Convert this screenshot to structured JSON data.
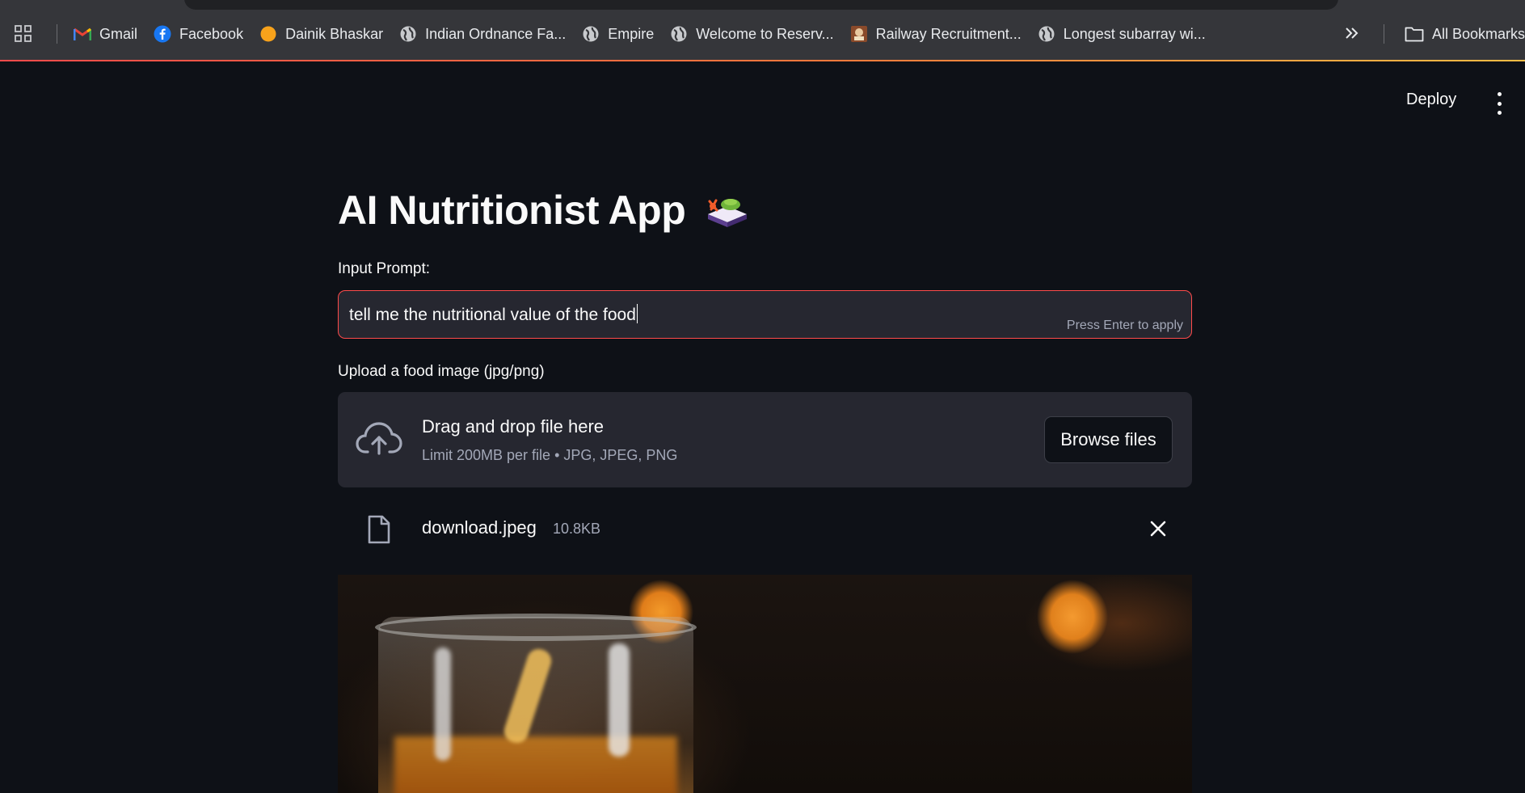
{
  "bookmarks_bar": {
    "items": [
      {
        "label": "Gmail",
        "icon": "gmail-icon"
      },
      {
        "label": "Facebook",
        "icon": "facebook-icon"
      },
      {
        "label": "Dainik Bhaskar",
        "icon": "dainik-bhaskar-icon"
      },
      {
        "label": "Indian Ordnance Fa...",
        "icon": "globe-icon"
      },
      {
        "label": "Empire",
        "icon": "globe-icon"
      },
      {
        "label": "Welcome to Reserv...",
        "icon": "globe-icon"
      },
      {
        "label": "Railway Recruitment...",
        "icon": "railway-icon"
      },
      {
        "label": "Longest subarray wi...",
        "icon": "globe-icon"
      }
    ],
    "all_bookmarks_label": "All Bookmarks"
  },
  "header": {
    "deploy_label": "Deploy"
  },
  "app": {
    "title": "AI Nutritionist App",
    "prompt_label": "Input Prompt:",
    "prompt_value": "tell me the nutritional value of the food",
    "prompt_hint": "Press Enter to apply",
    "upload_label": "Upload a food image (jpg/png)",
    "dropzone_title": "Drag and drop file here",
    "dropzone_subtitle": "Limit 200MB per file • JPG, JPEG, PNG",
    "browse_label": "Browse files",
    "file": {
      "name": "download.jpeg",
      "size": "10.8KB"
    }
  },
  "colors": {
    "background": "#0e1117",
    "accent": "#ff4b4b",
    "surface": "#262730"
  }
}
